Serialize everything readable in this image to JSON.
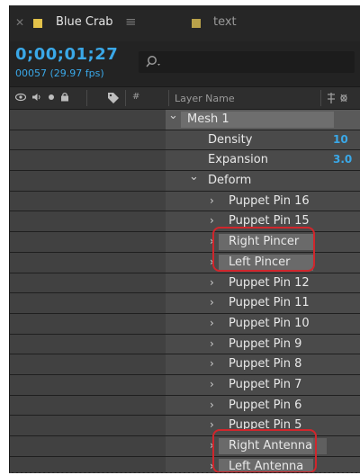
{
  "tabs": [
    {
      "label": "Blue Crab",
      "swatch_color": "#e3c24a",
      "active": true
    },
    {
      "label": "text",
      "swatch_color": "#b9a24a",
      "active": false
    }
  ],
  "time": {
    "timecode": "0;00;01;27",
    "frames": "00057 (29.97 fps)"
  },
  "header": {
    "column_name": "Layer Name"
  },
  "rows": [
    {
      "label": "Mesh 1",
      "indent": 0,
      "expanded": true,
      "kind": "mesh"
    },
    {
      "label": "Density",
      "indent": 1,
      "value": "10",
      "kind": "prop"
    },
    {
      "label": "Expansion",
      "indent": 1,
      "value": "3.0",
      "kind": "prop"
    },
    {
      "label": "Deform",
      "indent": 1,
      "expanded": true,
      "kind": "group"
    },
    {
      "label": "Puppet Pin 16",
      "indent": 2,
      "kind": "pin"
    },
    {
      "label": "Puppet Pin 15",
      "indent": 2,
      "kind": "pin"
    },
    {
      "label": "Right Pincer",
      "indent": 2,
      "kind": "pin"
    },
    {
      "label": "Left Pincer",
      "indent": 2,
      "kind": "pin"
    },
    {
      "label": "Puppet Pin 12",
      "indent": 2,
      "kind": "pin"
    },
    {
      "label": "Puppet Pin 11",
      "indent": 2,
      "kind": "pin"
    },
    {
      "label": "Puppet Pin 10",
      "indent": 2,
      "kind": "pin"
    },
    {
      "label": "Puppet Pin 9",
      "indent": 2,
      "kind": "pin"
    },
    {
      "label": "Puppet Pin 8",
      "indent": 2,
      "kind": "pin"
    },
    {
      "label": "Puppet Pin 7",
      "indent": 2,
      "kind": "pin"
    },
    {
      "label": "Puppet Pin 6",
      "indent": 2,
      "kind": "pin"
    },
    {
      "label": "Puppet Pin 5",
      "indent": 2,
      "kind": "pin"
    },
    {
      "label": "Right Antenna",
      "indent": 2,
      "kind": "pin"
    },
    {
      "label": "Left Antenna",
      "indent": 2,
      "kind": "pin"
    }
  ],
  "colors": {
    "accent": "#3aa8e8",
    "callout": "#d0262c"
  }
}
